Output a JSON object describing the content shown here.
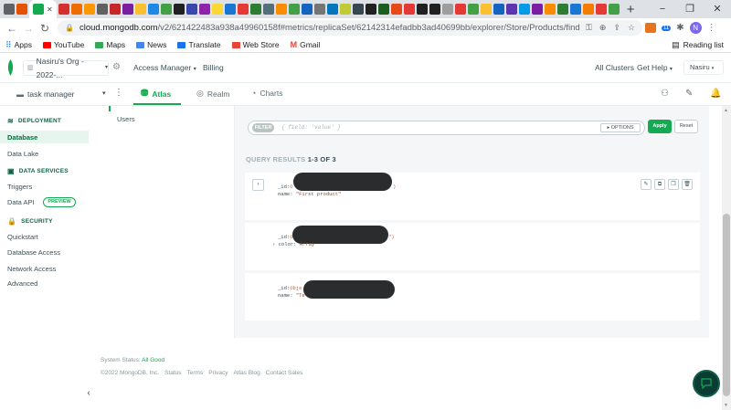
{
  "browser": {
    "url_host": "cloud.mongodb.com",
    "url_path": "/v2/621422483a938a49960158f#metrics/replicaSet/62142314efadbb3ad40699bb/explorer/Store/Products/find",
    "new_tab": "+",
    "window_controls": [
      "−",
      "❐",
      "✕"
    ],
    "profile_initial": "N",
    "ext_badge": "11"
  },
  "bookmarks": {
    "items": [
      "Apps",
      "YouTube",
      "Maps",
      "News",
      "Translate",
      "Web Store",
      "Gmail"
    ],
    "reading_list": "Reading list"
  },
  "atlas_top": {
    "org": "Nasiru's Org - 2022-...",
    "access_manager": "Access Manager",
    "billing": "Billing",
    "all_clusters": "All Clusters",
    "get_help": "Get Help",
    "user": "Nasiru"
  },
  "project": {
    "name": "task manager",
    "tabs": [
      "Atlas",
      "Realm",
      "Charts"
    ]
  },
  "leftnav": {
    "deployment": "DEPLOYMENT",
    "database": "Database",
    "data_lake": "Data Lake",
    "data_services": "DATA SERVICES",
    "triggers": "Triggers",
    "data_api": "Data API",
    "preview_badge": "PREVIEW",
    "security": "SECURITY",
    "quickstart": "Quickstart",
    "database_access": "Database Access",
    "network_access": "Network Access",
    "advanced": "Advanced"
  },
  "collections": {
    "users": "Users"
  },
  "query": {
    "filter_pill": "FILTER",
    "filter_placeholder": "{ field: 'value' }",
    "options": "▸ OPTIONS",
    "apply": "Apply",
    "reset": "Reset",
    "results_prefix": "QUERY RESULTS",
    "results_range": "1-3 OF 3"
  },
  "documents": [
    {
      "line1_key": "_id:",
      "line1_partial": "O",
      "line1_tail": ")",
      "line2_key": "name:",
      "line2_val": "\"First product\""
    },
    {
      "line1_key": "_id:",
      "line1_partial": "O",
      "line1_tail": "\")",
      "line2_prefix": "›",
      "line2_key": "color:",
      "line2_val": "Array"
    },
    {
      "line1_key": "_id:",
      "line1_partial": "Obje",
      "line2_key": "name:",
      "line2_val": "\"Te"
    }
  ],
  "footer": {
    "status_label": "System Status:",
    "status_value": "All Good",
    "copyright": "©2022 MongoDB, Inc.",
    "links": [
      "Status",
      "Terms",
      "Privacy",
      "Atlas Blog",
      "Contact Sales"
    ]
  },
  "colors": {
    "brand_green": "#13aa52",
    "dark_green": "#116149",
    "redaction": "#2a2c2e"
  }
}
